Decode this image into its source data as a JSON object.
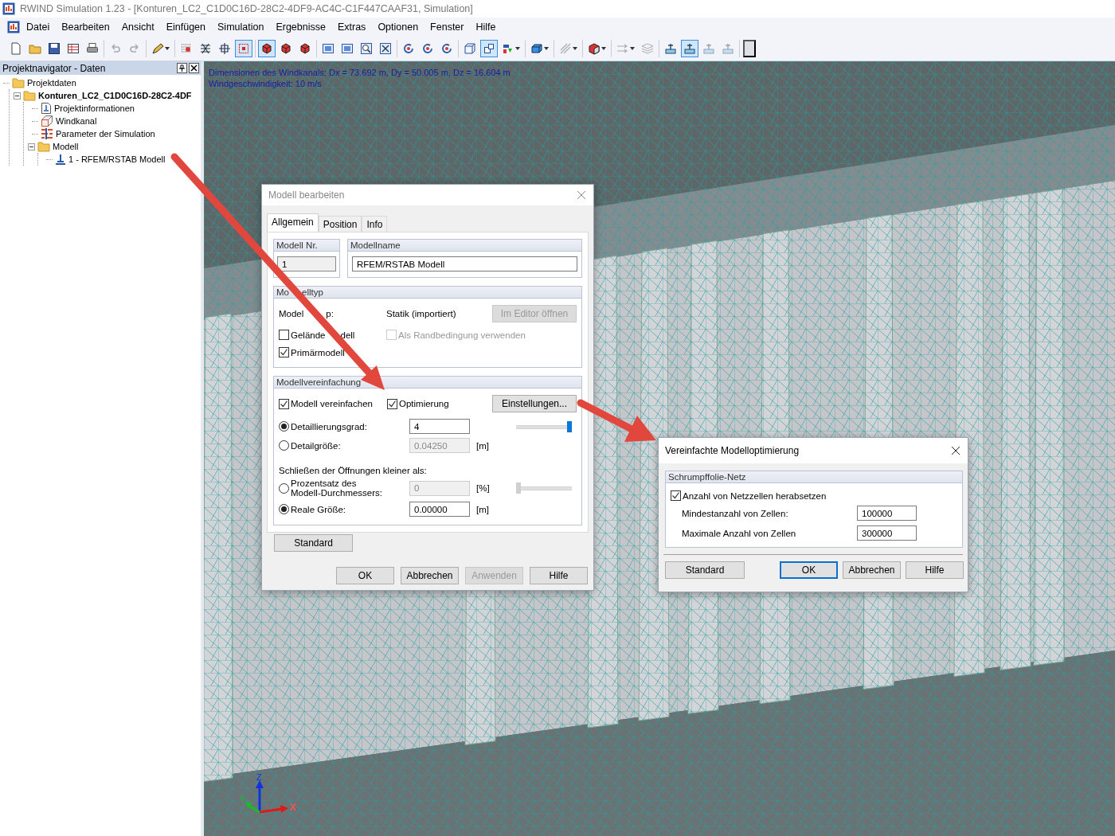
{
  "window": {
    "title": "RWIND Simulation 1.23 - [Konturen_LC2_C1D0C16D-28C2-4DF9-AC4C-C1F447CAAF31, Simulation]"
  },
  "menu": [
    "Datei",
    "Bearbeiten",
    "Ansicht",
    "Einfügen",
    "Simulation",
    "Ergebnisse",
    "Extras",
    "Optionen",
    "Fenster",
    "Hilfe"
  ],
  "toolbar_groups": [
    {
      "buttons": [
        {
          "kind": "page",
          "pressed": false,
          "disabled": false,
          "dropdown": false
        },
        {
          "kind": "folder",
          "pressed": false,
          "disabled": false,
          "dropdown": false
        },
        {
          "kind": "disk",
          "pressed": false,
          "disabled": false,
          "dropdown": false
        },
        {
          "kind": "table",
          "pressed": false,
          "disabled": false,
          "dropdown": false
        },
        {
          "kind": "printer",
          "pressed": false,
          "disabled": false,
          "dropdown": false
        }
      ]
    },
    {
      "buttons": [
        {
          "kind": "undo",
          "pressed": false,
          "disabled": true,
          "dropdown": false
        },
        {
          "kind": "redo",
          "pressed": false,
          "disabled": true,
          "dropdown": false
        }
      ]
    },
    {
      "buttons": [
        {
          "kind": "pen",
          "pressed": false,
          "disabled": false,
          "dropdown": true
        }
      ]
    },
    {
      "buttons": [
        {
          "kind": "dots",
          "pressed": false,
          "disabled": false,
          "dropdown": false
        },
        {
          "kind": "mesh",
          "pressed": false,
          "disabled": false,
          "dropdown": false
        },
        {
          "kind": "cross",
          "pressed": false,
          "disabled": false,
          "dropdown": false
        },
        {
          "kind": "target",
          "pressed": true,
          "disabled": false,
          "dropdown": false
        }
      ]
    },
    {
      "buttons": [
        {
          "kind": "solid",
          "pressed": true,
          "disabled": false,
          "dropdown": false
        },
        {
          "kind": "solid",
          "pressed": false,
          "disabled": false,
          "dropdown": false
        },
        {
          "kind": "solid",
          "pressed": false,
          "disabled": false,
          "dropdown": false
        }
      ]
    },
    {
      "buttons": [
        {
          "kind": "view",
          "pressed": false,
          "disabled": false,
          "dropdown": false
        },
        {
          "kind": "view",
          "pressed": false,
          "disabled": false,
          "dropdown": false
        },
        {
          "kind": "zoom",
          "pressed": false,
          "disabled": false,
          "dropdown": false
        },
        {
          "kind": "fit",
          "pressed": false,
          "disabled": false,
          "dropdown": false
        }
      ]
    },
    {
      "buttons": [
        {
          "kind": "rotate",
          "pressed": false,
          "disabled": false,
          "dropdown": false
        },
        {
          "kind": "rotate",
          "pressed": false,
          "disabled": false,
          "dropdown": false
        },
        {
          "kind": "rotate",
          "pressed": false,
          "disabled": false,
          "dropdown": false
        }
      ]
    },
    {
      "buttons": [
        {
          "kind": "wire",
          "pressed": false,
          "disabled": false,
          "dropdown": false
        },
        {
          "kind": "frame",
          "pressed": true,
          "disabled": false,
          "dropdown": false
        },
        {
          "kind": "vector",
          "pressed": false,
          "disabled": false,
          "dropdown": true
        }
      ]
    },
    {
      "buttons": [
        {
          "kind": "box",
          "pressed": false,
          "disabled": false,
          "dropdown": true
        }
      ]
    },
    {
      "buttons": [
        {
          "kind": "hatch",
          "pressed": false,
          "disabled": true,
          "dropdown": true
        }
      ]
    },
    {
      "buttons": [
        {
          "kind": "colorcube",
          "pressed": false,
          "disabled": false,
          "dropdown": true
        }
      ]
    },
    {
      "buttons": [
        {
          "kind": "flow",
          "pressed": false,
          "disabled": true,
          "dropdown": true
        },
        {
          "kind": "layers",
          "pressed": false,
          "disabled": true,
          "dropdown": false
        }
      ]
    },
    {
      "buttons": [
        {
          "kind": "probe",
          "pressed": false,
          "disabled": false,
          "dropdown": false
        },
        {
          "kind": "probe",
          "pressed": true,
          "disabled": false,
          "dropdown": false
        },
        {
          "kind": "probe",
          "pressed": false,
          "disabled": true,
          "dropdown": false
        },
        {
          "kind": "probe",
          "pressed": false,
          "disabled": true,
          "dropdown": false
        }
      ]
    }
  ],
  "navigator": {
    "title": "Projektnavigator - Daten",
    "tree": [
      {
        "label": "Projektdaten",
        "kind": "folder",
        "active": false,
        "children": [
          {
            "label": "Konturen_LC2_C1D0C16D-28C2-4DF",
            "kind": "folder",
            "active": true,
            "expanded": true,
            "children": [
              {
                "label": "Projektinformationen",
                "kind": "document",
                "active": false
              },
              {
                "label": "Windkanal",
                "kind": "tunnel",
                "active": false
              },
              {
                "label": "Parameter der Simulation",
                "kind": "params",
                "active": false
              },
              {
                "label": "Modell",
                "kind": "folder",
                "active": false,
                "expanded": true,
                "children": [
                  {
                    "label": "1 - RFEM/RSTAB Modell",
                    "kind": "model",
                    "active": false
                  }
                ]
              }
            ]
          }
        ]
      }
    ]
  },
  "viewport": {
    "info": [
      "Dimensionen des Windkanals: Dx = 73.692 m, Dy = 50.005 m, Dz = 16.604 m",
      "Windgeschwindigkeit: 10 m/s"
    ],
    "axes": [
      {
        "kind": "z",
        "label": "Z"
      },
      {
        "kind": "y",
        "label": "Y"
      },
      {
        "kind": "x",
        "label": "X"
      }
    ]
  },
  "edit_dialog": {
    "title": "Modell bearbeiten",
    "tabs": [
      {
        "label": "Allgemein",
        "selected": true
      },
      {
        "label": "Position",
        "selected": false
      },
      {
        "label": "Info",
        "selected": false
      }
    ],
    "model_no": {
      "title": "Modell Nr.",
      "value": "1"
    },
    "model_name": {
      "title": "Modellname",
      "value": "RFEM/RSTAB Modell"
    },
    "model_type": {
      "title_parts": [
        "Mo",
        "elltyp"
      ],
      "type_label_parts": [
        "Model",
        "p:"
      ],
      "type_value": "Statik (importiert)",
      "editor_button": {
        "label": "Im Editor öffnen",
        "disabled": true
      },
      "checks": [
        {
          "label_parts": [
            "Gelände",
            "dell"
          ],
          "checked": false,
          "disabled": false
        },
        {
          "label": "Als Randbedingung verwenden",
          "checked": false,
          "disabled": true
        },
        {
          "label": "Primärmodell",
          "checked": true,
          "disabled": false
        }
      ]
    },
    "simplification": {
      "title": "Modellvereinfachung",
      "checks": [
        {
          "label": "Modell vereinfachen",
          "checked": true,
          "disabled": false
        },
        {
          "label": "Optimierung",
          "checked": true,
          "disabled": false
        }
      ],
      "settings_button": "Einstellungen...",
      "detail_options": [
        {
          "label": "Detaillierungsgrad:",
          "selected": true,
          "value": "4",
          "disabled": false,
          "slider": {
            "level": 1
          }
        },
        {
          "label": "Detailgröße:",
          "selected": false,
          "value": "0.04250",
          "disabled": true,
          "unit": "[m]"
        }
      ],
      "closing_label": "Schließen der Öffnungen kleiner als:",
      "closing_options": [
        {
          "label": "Prozentsatz des Modell-Durchmessers:",
          "selected": false,
          "value": "0",
          "disabled": true,
          "unit": "[%]",
          "slider": {
            "level": 0
          }
        },
        {
          "label": "Reale Größe:",
          "selected": true,
          "value": "0.00000",
          "disabled": false,
          "unit": "[m]"
        }
      ]
    },
    "standard_button": "Standard",
    "buttons": [
      {
        "label": "OK",
        "disabled": false
      },
      {
        "label": "Abbrechen",
        "disabled": false
      },
      {
        "label": "Anwenden",
        "disabled": true
      },
      {
        "label": "Hilfe",
        "disabled": false
      }
    ]
  },
  "optimization_dialog": {
    "title": "Vereinfachte Modelloptimierung",
    "group_title": "Schrumpffolie-Netz",
    "check": {
      "label": "Anzahl von Netzzellen herabsetzen",
      "checked": true
    },
    "fields": [
      {
        "label": "Mindestanzahl von Zellen:",
        "value": "100000"
      },
      {
        "label": "Maximale Anzahl von Zellen",
        "value": "300000"
      }
    ],
    "standard_button": "Standard",
    "buttons": [
      {
        "label": "OK",
        "default": true
      },
      {
        "label": "Abbrechen",
        "default": false
      },
      {
        "label": "Hilfe",
        "default": false
      }
    ]
  }
}
